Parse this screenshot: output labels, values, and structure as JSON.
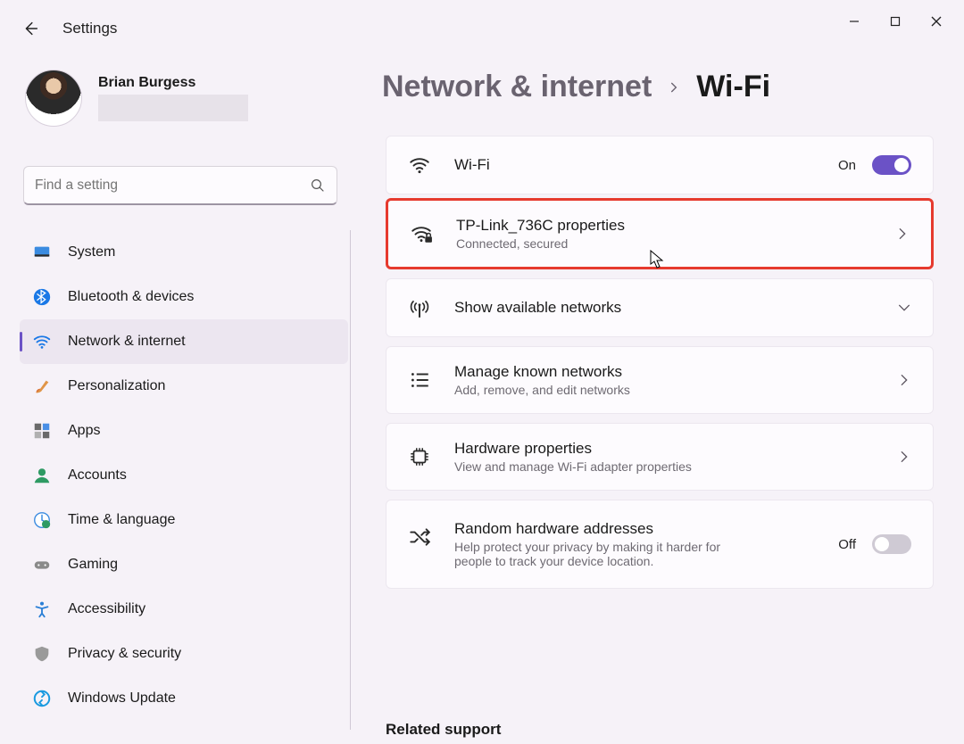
{
  "app": {
    "title": "Settings"
  },
  "user": {
    "name": "Brian Burgess"
  },
  "search": {
    "placeholder": "Find a setting"
  },
  "nav": {
    "items": [
      {
        "key": "system",
        "label": "System"
      },
      {
        "key": "bluetooth",
        "label": "Bluetooth & devices"
      },
      {
        "key": "network",
        "label": "Network & internet",
        "selected": true
      },
      {
        "key": "personalization",
        "label": "Personalization"
      },
      {
        "key": "apps",
        "label": "Apps"
      },
      {
        "key": "accounts",
        "label": "Accounts"
      },
      {
        "key": "time",
        "label": "Time & language"
      },
      {
        "key": "gaming",
        "label": "Gaming"
      },
      {
        "key": "accessibility",
        "label": "Accessibility"
      },
      {
        "key": "privacy",
        "label": "Privacy & security"
      },
      {
        "key": "update",
        "label": "Windows Update"
      }
    ]
  },
  "breadcrumb": {
    "parent": "Network & internet",
    "current": "Wi-Fi"
  },
  "cards": {
    "wifi": {
      "title": "Wi-Fi",
      "state_label": "On",
      "on": true
    },
    "connection": {
      "title": "TP-Link_736C properties",
      "sub": "Connected, secured"
    },
    "available": {
      "title": "Show available networks"
    },
    "known": {
      "title": "Manage known networks",
      "sub": "Add, remove, and edit networks"
    },
    "hardware": {
      "title": "Hardware properties",
      "sub": "View and manage Wi-Fi adapter properties"
    },
    "random": {
      "title": "Random hardware addresses",
      "sub": "Help protect your privacy by making it harder for people to track your device location.",
      "state_label": "Off",
      "on": false
    }
  },
  "related": {
    "title": "Related support"
  }
}
